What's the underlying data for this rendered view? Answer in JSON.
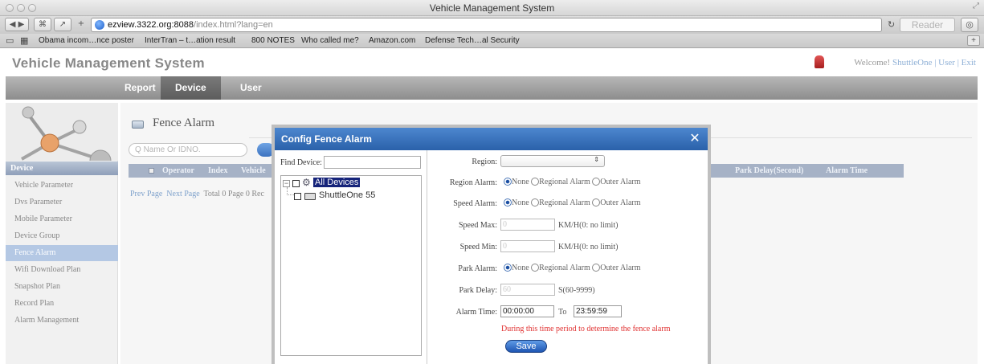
{
  "window": {
    "title": "Vehicle Management System"
  },
  "browser": {
    "url_host": "ezview.3322.org:8088",
    "url_path": "/index.html?lang=en",
    "reader_label": "Reader",
    "bookmarks": [
      "Obama incom…nce poster",
      "InterTran – t…ation result",
      "800 NOTES",
      "Who called me?",
      "Amazon.com",
      "Defense Tech…al Security"
    ]
  },
  "app": {
    "title": "Vehicle Management System",
    "welcome_prefix": "Welcome!",
    "user_name": "ShuttleOne",
    "user_link": "User",
    "exit_link": "Exit",
    "separator": "|"
  },
  "nav": {
    "tabs": [
      {
        "label": "Report"
      },
      {
        "label": "Device"
      },
      {
        "label": "User"
      }
    ]
  },
  "sidebar": {
    "header": "Device",
    "items": [
      {
        "label": "Vehicle Parameter"
      },
      {
        "label": "Dvs Parameter"
      },
      {
        "label": "Mobile Parameter"
      },
      {
        "label": "Device Group"
      },
      {
        "label": "Fence Alarm"
      },
      {
        "label": "Wifi Download Plan"
      },
      {
        "label": "Snapshot Plan"
      },
      {
        "label": "Record Plan"
      },
      {
        "label": "Alarm Management"
      }
    ]
  },
  "main": {
    "heading": "Fence Alarm",
    "search_placeholder": "Name Or IDNO.",
    "columns": [
      "Operator",
      "Index",
      "Vehicle",
      "Park Delay(Second)",
      "Alarm Time"
    ],
    "pager": {
      "prev": "Prev Page",
      "next": "Next Page",
      "info": "Total 0 Page  0 Rec"
    }
  },
  "modal": {
    "title": "Config Fence Alarm",
    "find_label": "Find Device:",
    "tree": {
      "root": "All Devices",
      "child": "ShuttleOne 55"
    },
    "region_label": "Region:",
    "region_alarm_label": "Region Alarm:",
    "speed_alarm_label": "Speed Alarm:",
    "speed_max_label": "Speed Max:",
    "speed_min_label": "Speed Min:",
    "park_alarm_label": "Park Alarm:",
    "park_delay_label": "Park Delay:",
    "alarm_time_label": "Alarm Time:",
    "radio_none": "None",
    "radio_regional": "Regional Alarm",
    "radio_outer": "Outer Alarm",
    "speed_max_value": "0",
    "speed_min_value": "0",
    "speed_hint": "KM/H(0: no limit)",
    "park_delay_value": "60",
    "park_delay_hint": "S(60-9999)",
    "time_from": "00:00:00",
    "time_to_label": "To",
    "time_to": "23:59:59",
    "warning": "During this time period to determine the fence alarm",
    "save_label": "Save"
  }
}
